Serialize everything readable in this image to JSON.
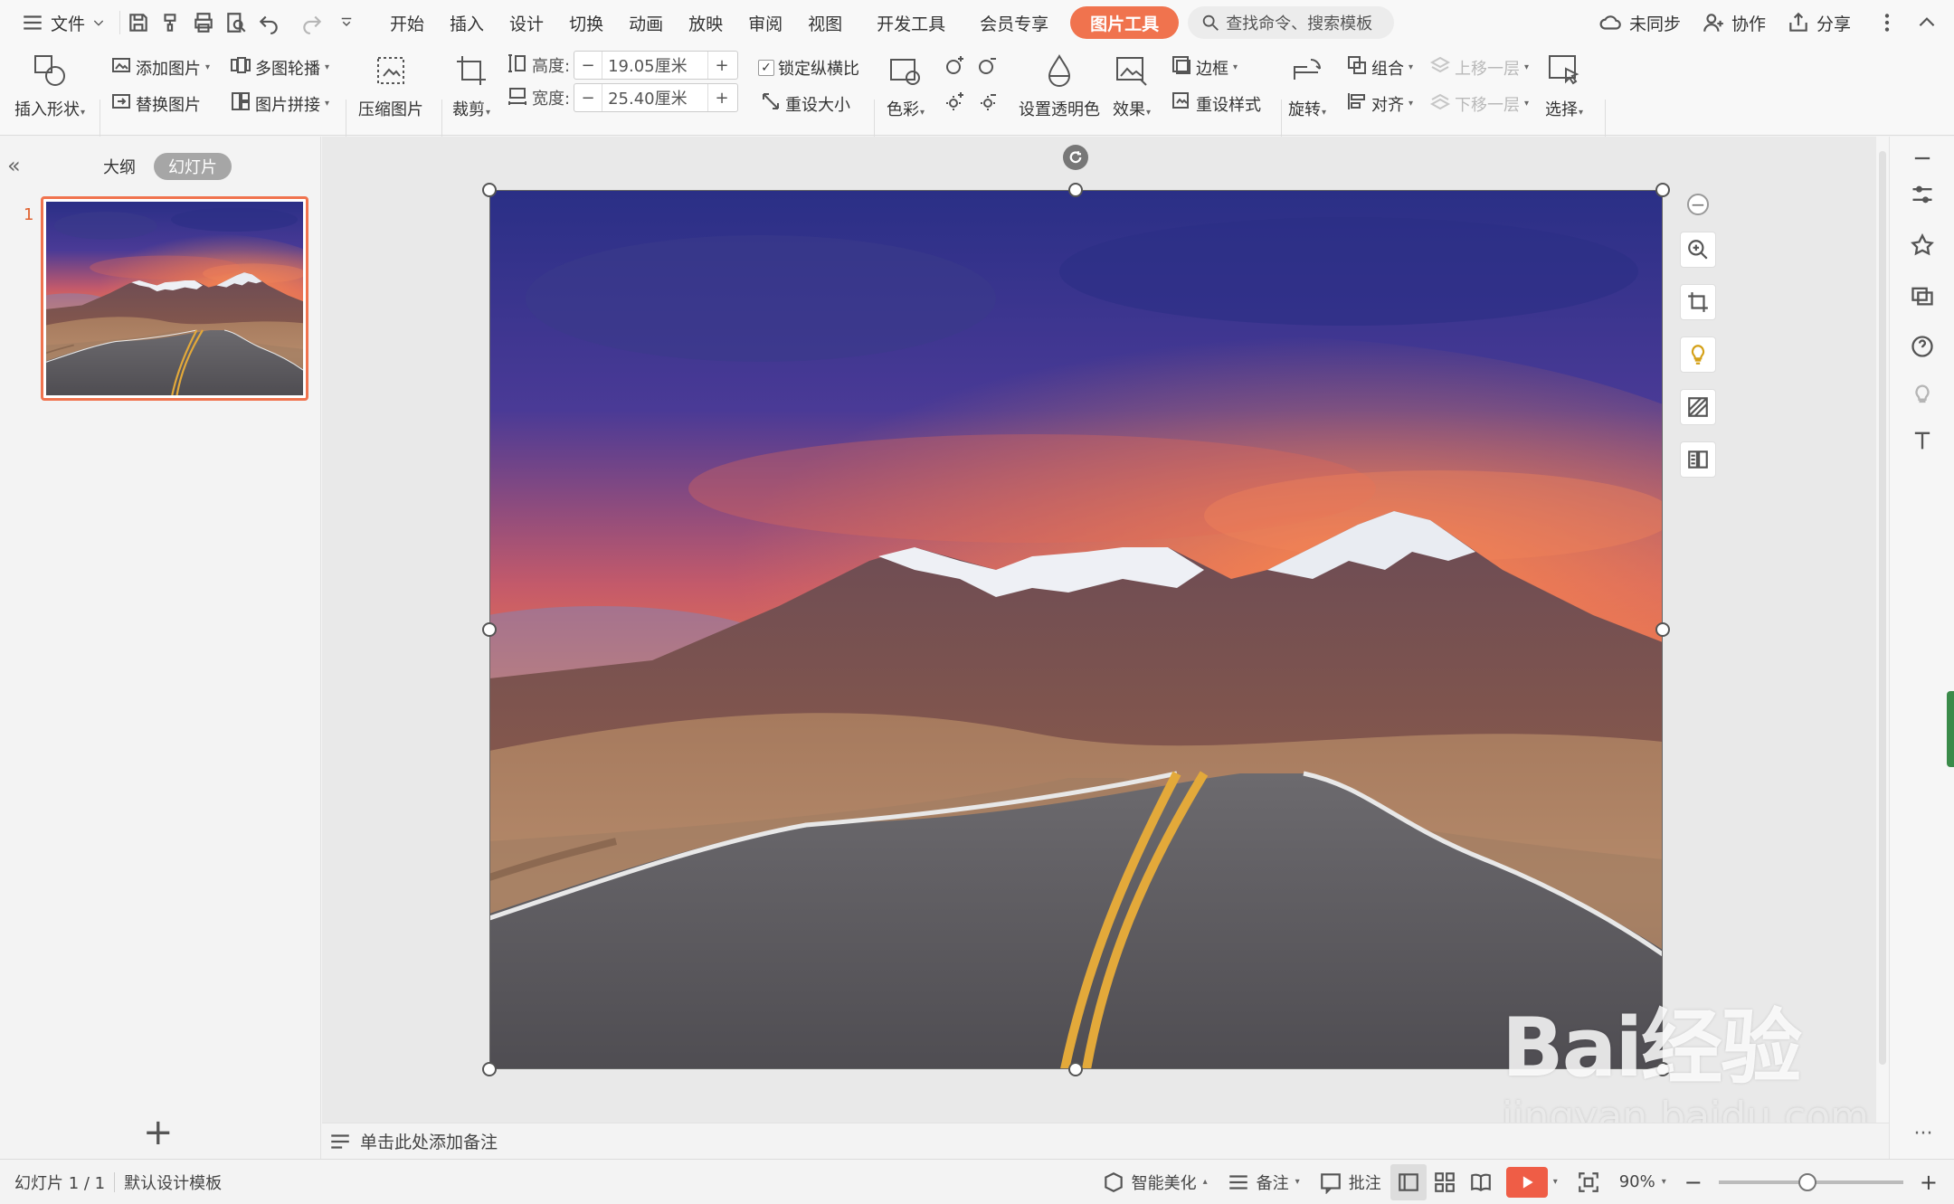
{
  "topbar": {
    "file_label": "文件",
    "menus": [
      "开始",
      "插入",
      "设计",
      "切换",
      "动画",
      "放映",
      "审阅",
      "视图",
      "开发工具",
      "会员专享"
    ],
    "active_tab": "图片工具",
    "search_placeholder": "查找命令、搜索模板",
    "sync_label": "未同步",
    "collab_label": "协作",
    "share_label": "分享"
  },
  "ribbon": {
    "insert_shape": "插入形状",
    "add_image": "添加图片",
    "replace_image": "替换图片",
    "carousel": "多图轮播",
    "collage": "图片拼接",
    "compress": "压缩图片",
    "crop": "裁剪",
    "height_label": "高度:",
    "height_value": "19.05厘米",
    "width_label": "宽度:",
    "width_value": "25.40厘米",
    "lock_ratio": "锁定纵横比",
    "reset_size": "重设大小",
    "color": "色彩",
    "transparent": "设置透明色",
    "effects": "效果",
    "border": "边框",
    "reset_style": "重设样式",
    "rotate": "旋转",
    "group": "组合",
    "align": "对齐",
    "bring_forward": "上移一层",
    "send_backward": "下移一层",
    "select": "选择"
  },
  "left_panel": {
    "tab_outline": "大纲",
    "tab_slides": "幻灯片",
    "slide_number": "1"
  },
  "notes_placeholder": "单击此处添加备注",
  "statusbar": {
    "slide_info": "幻灯片 1 / 1",
    "template": "默认设计模板",
    "beautify": "智能美化",
    "notes": "备注",
    "comments": "批注",
    "zoom": "90%"
  },
  "watermark": {
    "line1": "Bai经验",
    "line2": "jingyan.baidu.com"
  },
  "colors": {
    "accent": "#f0734e",
    "play": "#ef5d46"
  }
}
